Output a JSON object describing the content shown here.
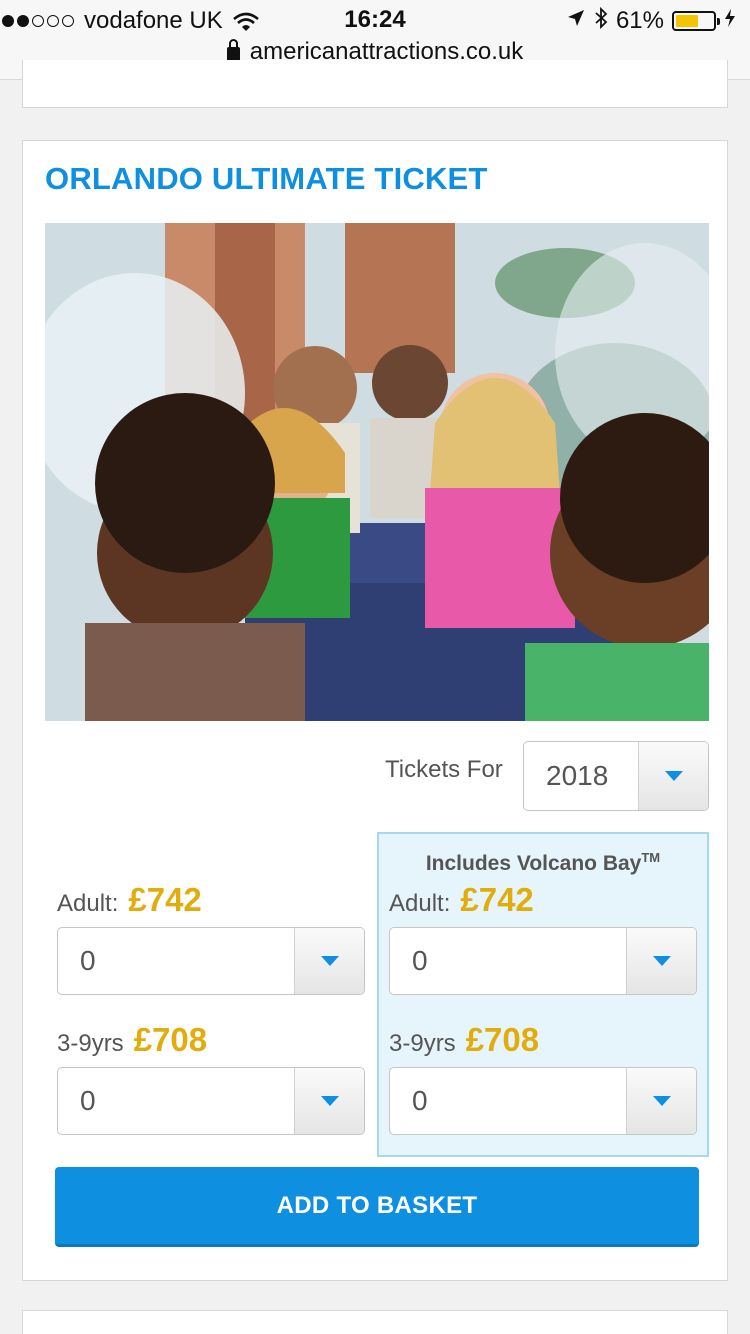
{
  "status_bar": {
    "carrier": "vodafone UK",
    "time": "16:24",
    "battery": "61%",
    "battery_level": 0.61,
    "signal_bars_filled": 2,
    "signal_bars_total": 5
  },
  "browser": {
    "url": "americanattractions.co.uk"
  },
  "product": {
    "title": "ORLANDO ULTIMATE TICKET",
    "image_alt": "Family splashed on a water ride",
    "tickets_for_label": "Tickets For",
    "year_value": "2018",
    "standard": {
      "adult_label": "Adult:",
      "adult_price": "£742",
      "adult_qty": "0",
      "child_label": "3-9yrs",
      "child_price": "£708",
      "child_qty": "0"
    },
    "volcano_bay": {
      "heading": "Includes Volcano Bay",
      "heading_mark": "TM",
      "adult_label": "Adult:",
      "adult_price": "£742",
      "adult_qty": "0",
      "child_label": "3-9yrs",
      "child_price": "£708",
      "child_qty": "0"
    },
    "add_button_label": "ADD TO BASKET"
  },
  "colors": {
    "accent_blue": "#0e8fe0",
    "price_gold": "#e2ad0b",
    "panel_bg": "#e6f4fb"
  },
  "icons": {
    "dropdown": "chevron-down-icon",
    "lock": "lock-icon",
    "wifi": "wifi-icon",
    "location": "location-arrow-icon",
    "bluetooth": "bluetooth-icon",
    "battery": "battery-icon",
    "charging": "charging-bolt-icon"
  }
}
